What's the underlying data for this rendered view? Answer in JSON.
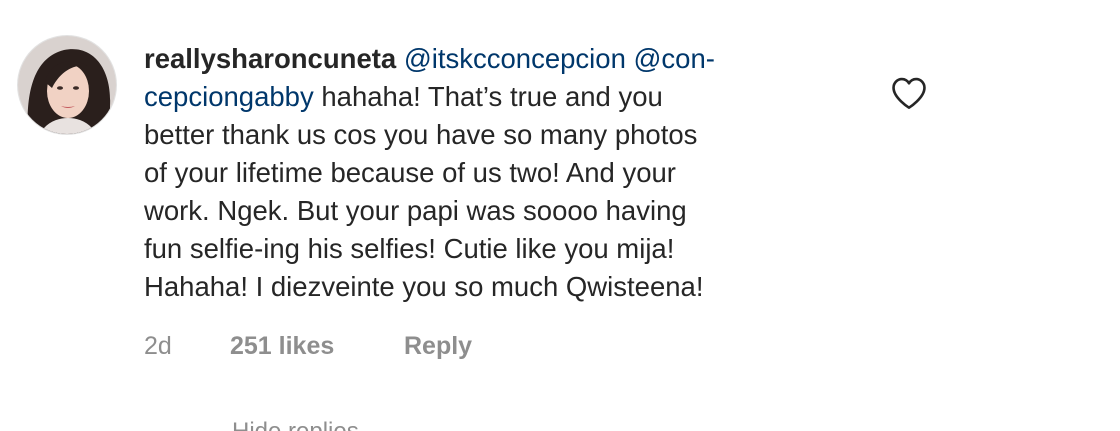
{
  "comment": {
    "username": "reallysharoncuneta",
    "mention_1": "@itskcconcepcion",
    "mention_2_part1": "@con-",
    "mention_2_part2": "cepciongabby",
    "line1_rest": " hahaha! That’s true and you",
    "line2": "better thank us cos you have so many photos",
    "line3": "of your lifetime because of us two! And your",
    "line4": "work. Ngek. But your papi was soooo having",
    "line5": "fun selfie-ing his selfies! Cutie like you mija!",
    "line6": "Hahaha! I diezveinte you so much Qwisteena!"
  },
  "meta": {
    "time": "2d",
    "likes": "251 likes",
    "reply_label": "Reply"
  },
  "replies_toggle": {
    "label": "Hide replies"
  },
  "icons": {
    "like": "heart-outline-icon",
    "avatar": "profile-photo"
  },
  "colors": {
    "text": "#262626",
    "secondary": "#8e8e8e",
    "link": "#00376b"
  }
}
